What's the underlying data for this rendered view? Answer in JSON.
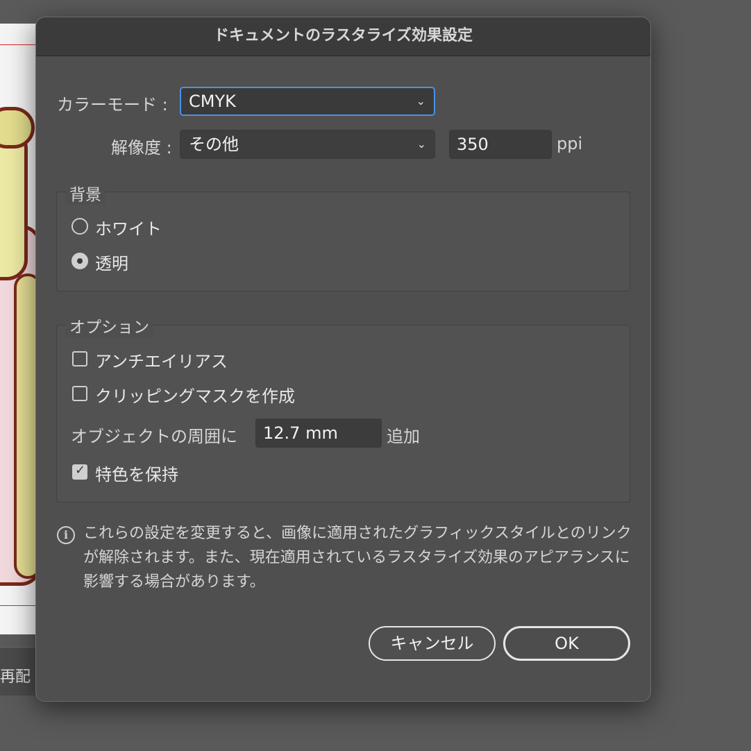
{
  "background": {
    "strip_text": "再配"
  },
  "dialog": {
    "title": "ドキュメントのラスタライズ効果設定",
    "color_mode": {
      "label": "カラーモード :",
      "value": "CMYK"
    },
    "resolution": {
      "label": "解像度 :",
      "value": "その他",
      "ppi_value": "350",
      "unit": "ppi"
    },
    "background_group": {
      "title": "背景",
      "options": [
        {
          "label": "ホワイト",
          "selected": false
        },
        {
          "label": "透明",
          "selected": true
        }
      ]
    },
    "options_group": {
      "title": "オプション",
      "anti_alias": {
        "label": "アンチエイリアス",
        "checked": false
      },
      "clipping_mask": {
        "label": "クリッピングマスクを作成",
        "checked": false
      },
      "padding": {
        "label": "オブジェクトの周囲に",
        "value": "12.7 mm",
        "suffix": "追加"
      },
      "preserve_spot": {
        "label": "特色を保持",
        "checked": true
      }
    },
    "info": {
      "icon": "info-icon",
      "text": "これらの設定を変更すると、画像に適用されたグラフィックスタイルとのリンクが解除されます。また、現在適用されているラスタライズ効果のアピアランスに影響する場合があります。"
    },
    "buttons": {
      "cancel": "キャンセル",
      "ok": "OK"
    }
  },
  "colors": {
    "accent_focus": "#4a90e8",
    "dialog_bg": "#4f4f4f"
  }
}
